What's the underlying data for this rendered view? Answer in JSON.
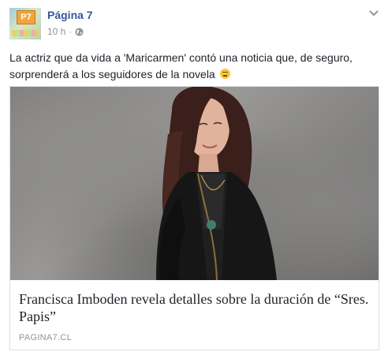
{
  "header": {
    "page_name": "Página 7",
    "avatar_logo_text": "P7",
    "time": "10 h",
    "separator": "·",
    "privacy_icon": "globe-icon",
    "menu_icon": "chevron-down-icon"
  },
  "post": {
    "text": "La actriz que da vida a 'Maricarmen' contó una noticia que, de seguro, sorprenderá a los seguidores de la novela",
    "emoji": "unamused-face-emoji"
  },
  "link_card": {
    "image_icon": "photo-of-woman",
    "title": "Francisca Imboden revela detalles sobre la duración de “Sres. Papis”",
    "domain": "PAGINA7.CL"
  },
  "colors": {
    "link_blue": "#365899",
    "meta_gray": "#90949c",
    "text": "#1d2129",
    "border": "#dddfe2"
  }
}
